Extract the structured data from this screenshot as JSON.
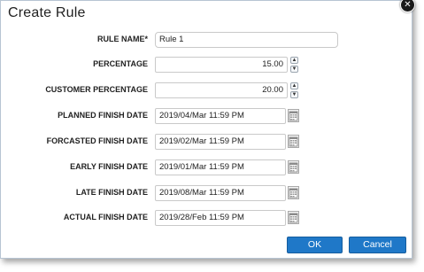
{
  "dialog": {
    "title": "Create Rule",
    "close_icon": "close-icon"
  },
  "fields": {
    "rule_name": {
      "label": "RULE NAME*",
      "value": "Rule 1"
    },
    "percentage": {
      "label": "PERCENTAGE",
      "value": "15.00"
    },
    "customer_percentage": {
      "label": "CUSTOMER PERCENTAGE",
      "value": "20.00"
    },
    "planned_finish_date": {
      "label": "PLANNED FINISH DATE",
      "value": "2019/04/Mar 11:59 PM"
    },
    "forcasted_finish_date": {
      "label": "FORCASTED FINISH DATE",
      "value": "2019/02/Mar 11:59 PM"
    },
    "early_finish_date": {
      "label": "EARLY FINISH DATE",
      "value": "2019/01/Mar 11:59 PM"
    },
    "late_finish_date": {
      "label": "LATE FINISH DATE",
      "value": "2019/08/Mar 11:59 PM"
    },
    "actual_finish_date": {
      "label": "ACTUAL FINISH DATE",
      "value": "2019/28/Feb 11:59 PM"
    }
  },
  "buttons": {
    "ok": "OK",
    "cancel": "Cancel"
  },
  "colors": {
    "primary_button": "#1f78c8",
    "border": "#c9c9c9"
  },
  "icons": {
    "spinner_up": "chevron-up-icon",
    "spinner_down": "chevron-down-icon",
    "calendar": "calendar-icon"
  }
}
